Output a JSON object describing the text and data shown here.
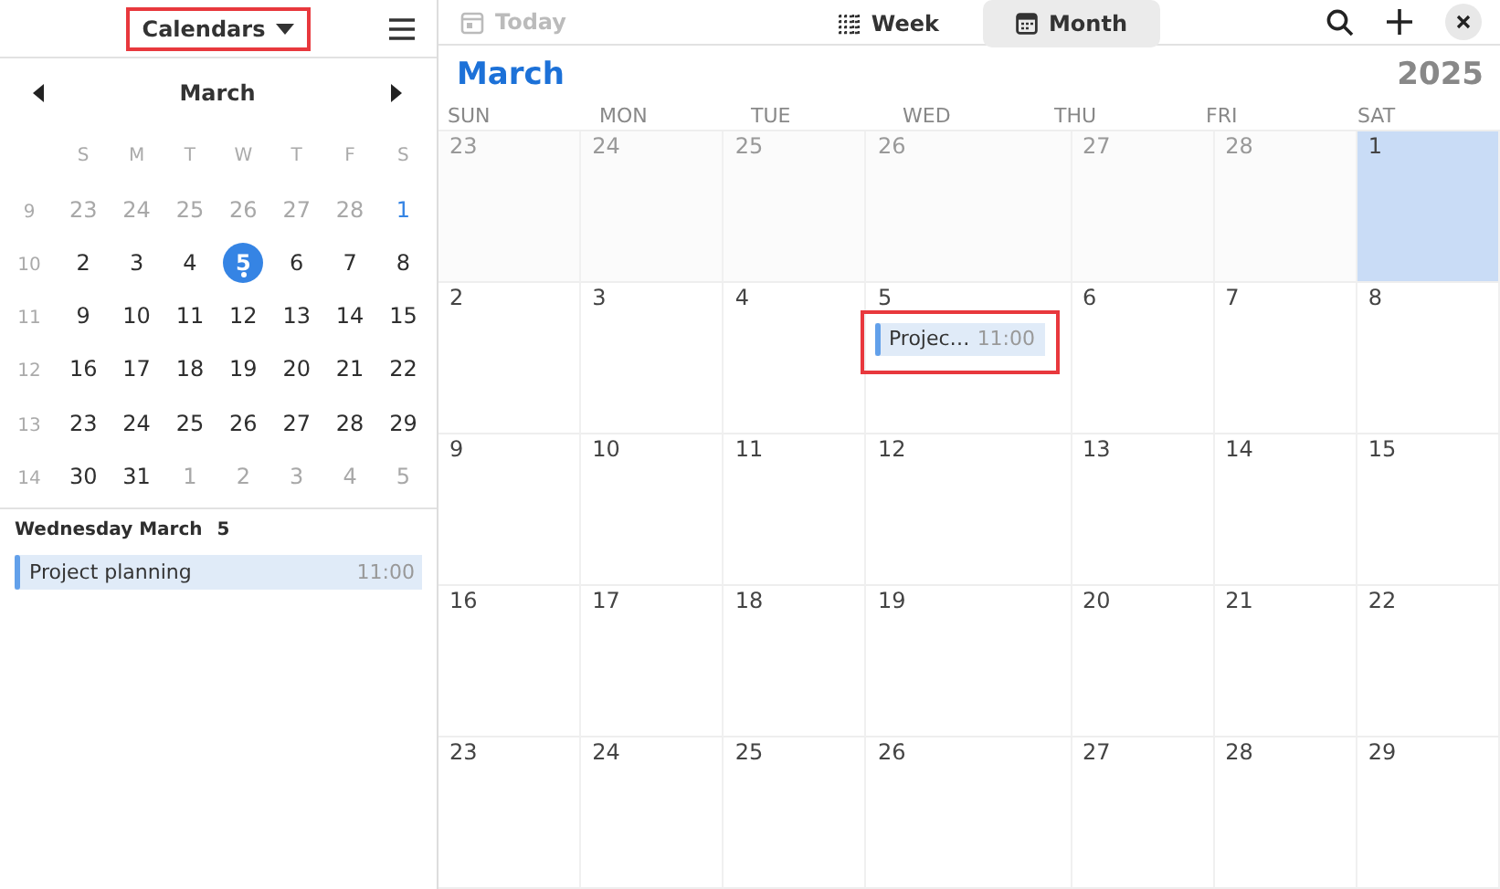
{
  "sidebar": {
    "calendars_button": {
      "label": "Calendars",
      "highlighted": true
    },
    "mini_calendar": {
      "month": "March",
      "weekdays": [
        "S",
        "M",
        "T",
        "W",
        "T",
        "F",
        "S"
      ],
      "weeks": [
        {
          "week": "9",
          "days": [
            {
              "label": "23",
              "outside": true,
              "today": false,
              "selected": false,
              "has_event": false
            },
            {
              "label": "24",
              "outside": true,
              "today": false,
              "selected": false,
              "has_event": false
            },
            {
              "label": "25",
              "outside": true,
              "today": false,
              "selected": false,
              "has_event": false
            },
            {
              "label": "26",
              "outside": true,
              "today": false,
              "selected": false,
              "has_event": false
            },
            {
              "label": "27",
              "outside": true,
              "today": false,
              "selected": false,
              "has_event": false
            },
            {
              "label": "28",
              "outside": true,
              "today": false,
              "selected": false,
              "has_event": false
            },
            {
              "label": "1",
              "outside": false,
              "today": false,
              "selected": true,
              "has_event": false
            }
          ]
        },
        {
          "week": "10",
          "days": [
            {
              "label": "2",
              "outside": false,
              "today": false,
              "selected": false,
              "has_event": false
            },
            {
              "label": "3",
              "outside": false,
              "today": false,
              "selected": false,
              "has_event": false
            },
            {
              "label": "4",
              "outside": false,
              "today": false,
              "selected": false,
              "has_event": false
            },
            {
              "label": "5",
              "outside": false,
              "today": true,
              "selected": false,
              "has_event": true
            },
            {
              "label": "6",
              "outside": false,
              "today": false,
              "selected": false,
              "has_event": false
            },
            {
              "label": "7",
              "outside": false,
              "today": false,
              "selected": false,
              "has_event": false
            },
            {
              "label": "8",
              "outside": false,
              "today": false,
              "selected": false,
              "has_event": false
            }
          ]
        },
        {
          "week": "11",
          "days": [
            {
              "label": "9",
              "outside": false,
              "today": false,
              "selected": false,
              "has_event": false
            },
            {
              "label": "10",
              "outside": false,
              "today": false,
              "selected": false,
              "has_event": false
            },
            {
              "label": "11",
              "outside": false,
              "today": false,
              "selected": false,
              "has_event": false
            },
            {
              "label": "12",
              "outside": false,
              "today": false,
              "selected": false,
              "has_event": false
            },
            {
              "label": "13",
              "outside": false,
              "today": false,
              "selected": false,
              "has_event": false
            },
            {
              "label": "14",
              "outside": false,
              "today": false,
              "selected": false,
              "has_event": false
            },
            {
              "label": "15",
              "outside": false,
              "today": false,
              "selected": false,
              "has_event": false
            }
          ]
        },
        {
          "week": "12",
          "days": [
            {
              "label": "16",
              "outside": false,
              "today": false,
              "selected": false,
              "has_event": false
            },
            {
              "label": "17",
              "outside": false,
              "today": false,
              "selected": false,
              "has_event": false
            },
            {
              "label": "18",
              "outside": false,
              "today": false,
              "selected": false,
              "has_event": false
            },
            {
              "label": "19",
              "outside": false,
              "today": false,
              "selected": false,
              "has_event": false
            },
            {
              "label": "20",
              "outside": false,
              "today": false,
              "selected": false,
              "has_event": false
            },
            {
              "label": "21",
              "outside": false,
              "today": false,
              "selected": false,
              "has_event": false
            },
            {
              "label": "22",
              "outside": false,
              "today": false,
              "selected": false,
              "has_event": false
            }
          ]
        },
        {
          "week": "13",
          "days": [
            {
              "label": "23",
              "outside": false,
              "today": false,
              "selected": false,
              "has_event": false
            },
            {
              "label": "24",
              "outside": false,
              "today": false,
              "selected": false,
              "has_event": false
            },
            {
              "label": "25",
              "outside": false,
              "today": false,
              "selected": false,
              "has_event": false
            },
            {
              "label": "26",
              "outside": false,
              "today": false,
              "selected": false,
              "has_event": false
            },
            {
              "label": "27",
              "outside": false,
              "today": false,
              "selected": false,
              "has_event": false
            },
            {
              "label": "28",
              "outside": false,
              "today": false,
              "selected": false,
              "has_event": false
            },
            {
              "label": "29",
              "outside": false,
              "today": false,
              "selected": false,
              "has_event": false
            }
          ]
        },
        {
          "week": "14",
          "days": [
            {
              "label": "30",
              "outside": false,
              "today": false,
              "selected": false,
              "has_event": false
            },
            {
              "label": "31",
              "outside": false,
              "today": false,
              "selected": false,
              "has_event": false
            },
            {
              "label": "1",
              "outside": true,
              "today": false,
              "selected": false,
              "has_event": false
            },
            {
              "label": "2",
              "outside": true,
              "today": false,
              "selected": false,
              "has_event": false
            },
            {
              "label": "3",
              "outside": true,
              "today": false,
              "selected": false,
              "has_event": false
            },
            {
              "label": "4",
              "outside": true,
              "today": false,
              "selected": false,
              "has_event": false
            },
            {
              "label": "5",
              "outside": true,
              "today": false,
              "selected": false,
              "has_event": false
            }
          ]
        }
      ]
    },
    "agenda": {
      "heading": "Wednesday March",
      "day": "5",
      "events": [
        {
          "title": "Project planning",
          "time": "11:00",
          "color": "#62a0ea"
        }
      ]
    }
  },
  "toolbar": {
    "today": {
      "label": "Today",
      "disabled": true
    },
    "views": [
      {
        "label": "Week",
        "selected": false
      },
      {
        "label": "Month",
        "selected": true
      }
    ]
  },
  "month_view": {
    "month": "March",
    "year": "2025",
    "weekdays": [
      "SUN",
      "MON",
      "TUE",
      "WED",
      "THU",
      "FRI",
      "SAT"
    ],
    "weeks": [
      [
        {
          "label": "23",
          "outside": true,
          "selected": false
        },
        {
          "label": "24",
          "outside": true,
          "selected": false
        },
        {
          "label": "25",
          "outside": true,
          "selected": false
        },
        {
          "label": "26",
          "outside": true,
          "selected": false
        },
        {
          "label": "27",
          "outside": true,
          "selected": false
        },
        {
          "label": "28",
          "outside": true,
          "selected": false
        },
        {
          "label": "1",
          "outside": false,
          "selected": true
        }
      ],
      [
        {
          "label": "2",
          "outside": false,
          "selected": false
        },
        {
          "label": "3",
          "outside": false,
          "selected": false
        },
        {
          "label": "4",
          "outside": false,
          "selected": false
        },
        {
          "label": "5",
          "outside": false,
          "selected": false,
          "events": [
            {
              "title": "Projec…",
              "time": "11:00",
              "color": "#62a0ea",
              "highlighted": true
            }
          ]
        },
        {
          "label": "6",
          "outside": false,
          "selected": false
        },
        {
          "label": "7",
          "outside": false,
          "selected": false
        },
        {
          "label": "8",
          "outside": false,
          "selected": false
        }
      ],
      [
        {
          "label": "9",
          "outside": false,
          "selected": false
        },
        {
          "label": "10",
          "outside": false,
          "selected": false
        },
        {
          "label": "11",
          "outside": false,
          "selected": false
        },
        {
          "label": "12",
          "outside": false,
          "selected": false
        },
        {
          "label": "13",
          "outside": false,
          "selected": false
        },
        {
          "label": "14",
          "outside": false,
          "selected": false
        },
        {
          "label": "15",
          "outside": false,
          "selected": false
        }
      ],
      [
        {
          "label": "16",
          "outside": false,
          "selected": false
        },
        {
          "label": "17",
          "outside": false,
          "selected": false
        },
        {
          "label": "18",
          "outside": false,
          "selected": false
        },
        {
          "label": "19",
          "outside": false,
          "selected": false
        },
        {
          "label": "20",
          "outside": false,
          "selected": false
        },
        {
          "label": "21",
          "outside": false,
          "selected": false
        },
        {
          "label": "22",
          "outside": false,
          "selected": false
        }
      ],
      [
        {
          "label": "23",
          "outside": false,
          "selected": false
        },
        {
          "label": "24",
          "outside": false,
          "selected": false
        },
        {
          "label": "25",
          "outside": false,
          "selected": false
        },
        {
          "label": "26",
          "outside": false,
          "selected": false
        },
        {
          "label": "27",
          "outside": false,
          "selected": false
        },
        {
          "label": "28",
          "outside": false,
          "selected": false
        },
        {
          "label": "29",
          "outside": false,
          "selected": false
        }
      ]
    ]
  }
}
